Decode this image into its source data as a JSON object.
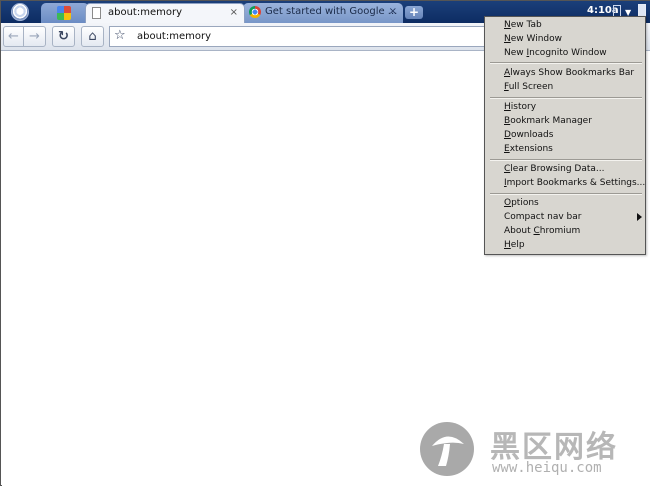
{
  "tabs": {
    "active_title": "about:memory",
    "background_title": "Get started with Google ...",
    "close_glyph": "×",
    "new_tab_glyph": "+"
  },
  "status": {
    "time": "4:10a"
  },
  "toolbar": {
    "back_glyph": "←",
    "forward_glyph": "→",
    "reload_glyph": "↻",
    "home_glyph": "⌂",
    "star_glyph": "☆",
    "url": "about:memory"
  },
  "menu": {
    "new_tab": {
      "u": "N",
      "rest": "ew Tab"
    },
    "new_window": {
      "u": "N",
      "rest": "ew Window"
    },
    "new_incognito_pre": "New ",
    "new_incognito_u": "I",
    "new_incognito_rest": "ncognito Window",
    "always_show_bookmarks": {
      "u": "A",
      "rest": "lways Show Bookmarks Bar"
    },
    "full_screen": {
      "u": "F",
      "rest": "ull Screen"
    },
    "history": {
      "u": "H",
      "rest": "istory"
    },
    "bookmark_manager": {
      "u": "B",
      "rest": "ookmark Manager"
    },
    "downloads": {
      "u": "D",
      "rest": "ownloads"
    },
    "extensions": {
      "u": "E",
      "rest": "xtensions"
    },
    "clear_browsing_data": {
      "u": "C",
      "rest": "lear Browsing Data..."
    },
    "import_bookmarks": {
      "u": "I",
      "rest": "mport Bookmarks & Settings..."
    },
    "options": {
      "u": "O",
      "rest": "ptions"
    },
    "compact_nav_bar": "Compact nav bar",
    "about_pre": "About ",
    "about_u": "C",
    "about_rest": "hromium",
    "help": {
      "u": "H",
      "rest": "elp"
    }
  },
  "watermark": {
    "chinese_text": "黑区网络",
    "url": "www.heiqu.com"
  }
}
